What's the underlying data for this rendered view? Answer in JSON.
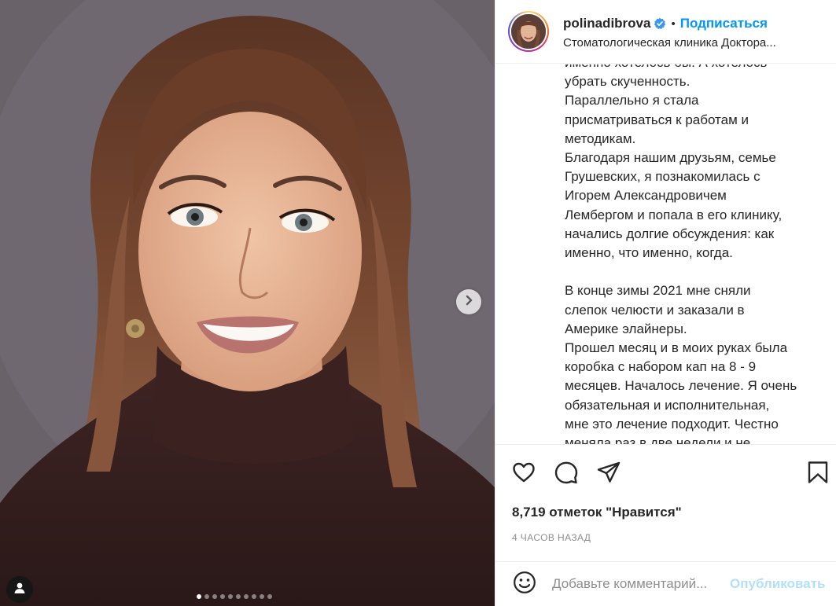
{
  "post": {
    "image_alt_icon": "portrait-photo",
    "carousel": {
      "total": 10,
      "active_index": 0
    },
    "next_icon": "chevron-right-icon",
    "user_tag_icon": "user-icon"
  },
  "header": {
    "username": "polinadibrova",
    "verified_icon": "verified-badge-icon",
    "bullet": "•",
    "follow_label": "Подписаться",
    "location": "Стоматологическая клиника Доктора..."
  },
  "caption": {
    "text": "именно хотелось бы. А хотелось\nубрать скученность.\nПараллельно я стала\nприсматриваться к работам и\nметодикам.\nБлагодаря нашим друзьям, семье\nГрушевских, я познакомилась с\nИгорем Александровичем\nЛембергом и попала в его клинику,\nначались долгие обсуждения: как\nименно, что именно, когда.\n\nВ конце зимы 2021 мне сняли\nслепок челюсти и заказали в\nАмерике элайнеры.\nПрошел месяц и в моих руках была\nкоробка с набором кап на 8 - 9\nмесяцев. Началось лечение. Я очень\nобязательная и исполнительная,\nмне это лечение подходит. Честно\nменяла раз в две недели и не"
  },
  "actions": {
    "like_icon": "heart-icon",
    "comment_icon": "comment-icon",
    "share_icon": "send-icon",
    "save_icon": "bookmark-icon"
  },
  "likes_text": "8,719 отметок \"Нравится\"",
  "time_text": "4 часов назад",
  "comment": {
    "emoji_icon": "emoji-icon",
    "placeholder": "Добавьте комментарий...",
    "value": "",
    "publish_label": "Опубликовать"
  },
  "colors": {
    "accent": "#0095f6",
    "publish_disabled": "#b2dffc",
    "muted": "#8e8e8e",
    "text": "#262626"
  }
}
